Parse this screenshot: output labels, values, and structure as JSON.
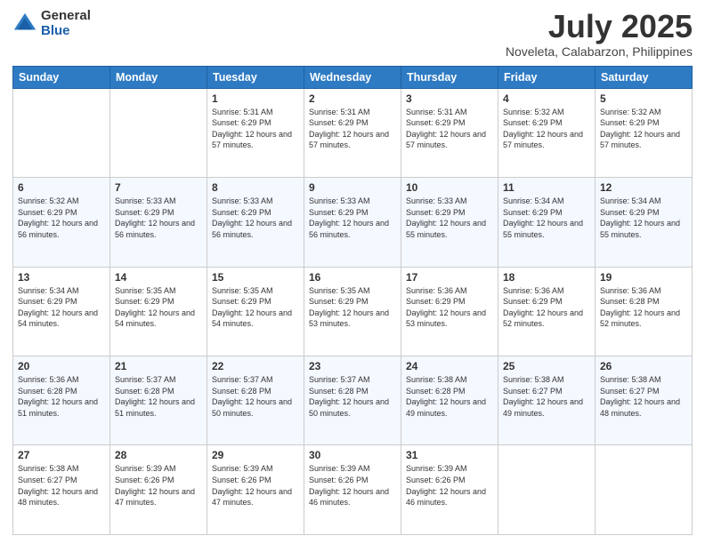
{
  "header": {
    "logo_general": "General",
    "logo_blue": "Blue",
    "month_title": "July 2025",
    "subtitle": "Noveleta, Calabarzon, Philippines"
  },
  "days_of_week": [
    "Sunday",
    "Monday",
    "Tuesday",
    "Wednesday",
    "Thursday",
    "Friday",
    "Saturday"
  ],
  "weeks": [
    [
      {
        "day": "",
        "sunrise": "",
        "sunset": "",
        "daylight": ""
      },
      {
        "day": "",
        "sunrise": "",
        "sunset": "",
        "daylight": ""
      },
      {
        "day": "1",
        "sunrise": "Sunrise: 5:31 AM",
        "sunset": "Sunset: 6:29 PM",
        "daylight": "Daylight: 12 hours and 57 minutes."
      },
      {
        "day": "2",
        "sunrise": "Sunrise: 5:31 AM",
        "sunset": "Sunset: 6:29 PM",
        "daylight": "Daylight: 12 hours and 57 minutes."
      },
      {
        "day": "3",
        "sunrise": "Sunrise: 5:31 AM",
        "sunset": "Sunset: 6:29 PM",
        "daylight": "Daylight: 12 hours and 57 minutes."
      },
      {
        "day": "4",
        "sunrise": "Sunrise: 5:32 AM",
        "sunset": "Sunset: 6:29 PM",
        "daylight": "Daylight: 12 hours and 57 minutes."
      },
      {
        "day": "5",
        "sunrise": "Sunrise: 5:32 AM",
        "sunset": "Sunset: 6:29 PM",
        "daylight": "Daylight: 12 hours and 57 minutes."
      }
    ],
    [
      {
        "day": "6",
        "sunrise": "Sunrise: 5:32 AM",
        "sunset": "Sunset: 6:29 PM",
        "daylight": "Daylight: 12 hours and 56 minutes."
      },
      {
        "day": "7",
        "sunrise": "Sunrise: 5:33 AM",
        "sunset": "Sunset: 6:29 PM",
        "daylight": "Daylight: 12 hours and 56 minutes."
      },
      {
        "day": "8",
        "sunrise": "Sunrise: 5:33 AM",
        "sunset": "Sunset: 6:29 PM",
        "daylight": "Daylight: 12 hours and 56 minutes."
      },
      {
        "day": "9",
        "sunrise": "Sunrise: 5:33 AM",
        "sunset": "Sunset: 6:29 PM",
        "daylight": "Daylight: 12 hours and 56 minutes."
      },
      {
        "day": "10",
        "sunrise": "Sunrise: 5:33 AM",
        "sunset": "Sunset: 6:29 PM",
        "daylight": "Daylight: 12 hours and 55 minutes."
      },
      {
        "day": "11",
        "sunrise": "Sunrise: 5:34 AM",
        "sunset": "Sunset: 6:29 PM",
        "daylight": "Daylight: 12 hours and 55 minutes."
      },
      {
        "day": "12",
        "sunrise": "Sunrise: 5:34 AM",
        "sunset": "Sunset: 6:29 PM",
        "daylight": "Daylight: 12 hours and 55 minutes."
      }
    ],
    [
      {
        "day": "13",
        "sunrise": "Sunrise: 5:34 AM",
        "sunset": "Sunset: 6:29 PM",
        "daylight": "Daylight: 12 hours and 54 minutes."
      },
      {
        "day": "14",
        "sunrise": "Sunrise: 5:35 AM",
        "sunset": "Sunset: 6:29 PM",
        "daylight": "Daylight: 12 hours and 54 minutes."
      },
      {
        "day": "15",
        "sunrise": "Sunrise: 5:35 AM",
        "sunset": "Sunset: 6:29 PM",
        "daylight": "Daylight: 12 hours and 54 minutes."
      },
      {
        "day": "16",
        "sunrise": "Sunrise: 5:35 AM",
        "sunset": "Sunset: 6:29 PM",
        "daylight": "Daylight: 12 hours and 53 minutes."
      },
      {
        "day": "17",
        "sunrise": "Sunrise: 5:36 AM",
        "sunset": "Sunset: 6:29 PM",
        "daylight": "Daylight: 12 hours and 53 minutes."
      },
      {
        "day": "18",
        "sunrise": "Sunrise: 5:36 AM",
        "sunset": "Sunset: 6:29 PM",
        "daylight": "Daylight: 12 hours and 52 minutes."
      },
      {
        "day": "19",
        "sunrise": "Sunrise: 5:36 AM",
        "sunset": "Sunset: 6:28 PM",
        "daylight": "Daylight: 12 hours and 52 minutes."
      }
    ],
    [
      {
        "day": "20",
        "sunrise": "Sunrise: 5:36 AM",
        "sunset": "Sunset: 6:28 PM",
        "daylight": "Daylight: 12 hours and 51 minutes."
      },
      {
        "day": "21",
        "sunrise": "Sunrise: 5:37 AM",
        "sunset": "Sunset: 6:28 PM",
        "daylight": "Daylight: 12 hours and 51 minutes."
      },
      {
        "day": "22",
        "sunrise": "Sunrise: 5:37 AM",
        "sunset": "Sunset: 6:28 PM",
        "daylight": "Daylight: 12 hours and 50 minutes."
      },
      {
        "day": "23",
        "sunrise": "Sunrise: 5:37 AM",
        "sunset": "Sunset: 6:28 PM",
        "daylight": "Daylight: 12 hours and 50 minutes."
      },
      {
        "day": "24",
        "sunrise": "Sunrise: 5:38 AM",
        "sunset": "Sunset: 6:28 PM",
        "daylight": "Daylight: 12 hours and 49 minutes."
      },
      {
        "day": "25",
        "sunrise": "Sunrise: 5:38 AM",
        "sunset": "Sunset: 6:27 PM",
        "daylight": "Daylight: 12 hours and 49 minutes."
      },
      {
        "day": "26",
        "sunrise": "Sunrise: 5:38 AM",
        "sunset": "Sunset: 6:27 PM",
        "daylight": "Daylight: 12 hours and 48 minutes."
      }
    ],
    [
      {
        "day": "27",
        "sunrise": "Sunrise: 5:38 AM",
        "sunset": "Sunset: 6:27 PM",
        "daylight": "Daylight: 12 hours and 48 minutes."
      },
      {
        "day": "28",
        "sunrise": "Sunrise: 5:39 AM",
        "sunset": "Sunset: 6:26 PM",
        "daylight": "Daylight: 12 hours and 47 minutes."
      },
      {
        "day": "29",
        "sunrise": "Sunrise: 5:39 AM",
        "sunset": "Sunset: 6:26 PM",
        "daylight": "Daylight: 12 hours and 47 minutes."
      },
      {
        "day": "30",
        "sunrise": "Sunrise: 5:39 AM",
        "sunset": "Sunset: 6:26 PM",
        "daylight": "Daylight: 12 hours and 46 minutes."
      },
      {
        "day": "31",
        "sunrise": "Sunrise: 5:39 AM",
        "sunset": "Sunset: 6:26 PM",
        "daylight": "Daylight: 12 hours and 46 minutes."
      },
      {
        "day": "",
        "sunrise": "",
        "sunset": "",
        "daylight": ""
      },
      {
        "day": "",
        "sunrise": "",
        "sunset": "",
        "daylight": ""
      }
    ]
  ]
}
